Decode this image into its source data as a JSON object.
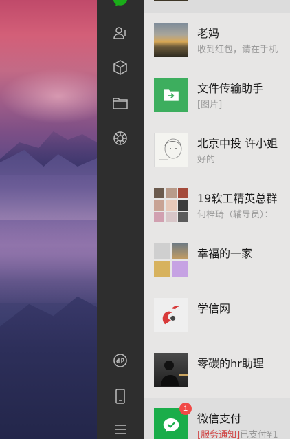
{
  "desktop": {
    "wallpaper": "mountain-sunset-wallpaper"
  },
  "sidebar": {
    "bg": "#2e2e2e",
    "active_color": "#1aad19",
    "icons": [
      "chat-icon",
      "contacts-icon",
      "favorites-icon",
      "files-icon",
      "moments-icon",
      "mini-programs-icon",
      "phone-icon",
      "menu-icon"
    ]
  },
  "chats": [
    {
      "name": "老妈",
      "preview": "收到红包，请在手机"
    },
    {
      "name": "文件传输助手",
      "preview": "[图片]"
    },
    {
      "name": "北京中投 许小姐",
      "preview": "好的"
    },
    {
      "name": "19软工精英总群",
      "preview": "何梓琦（辅导员）："
    },
    {
      "name": "幸福的一家",
      "preview": ""
    },
    {
      "name": "学信网",
      "preview": ""
    },
    {
      "name": "零碳的hr助理",
      "preview": ""
    },
    {
      "name": "微信支付",
      "preview_tag": "[服务通知]",
      "preview": "已支付¥1",
      "badge": "1"
    }
  ]
}
